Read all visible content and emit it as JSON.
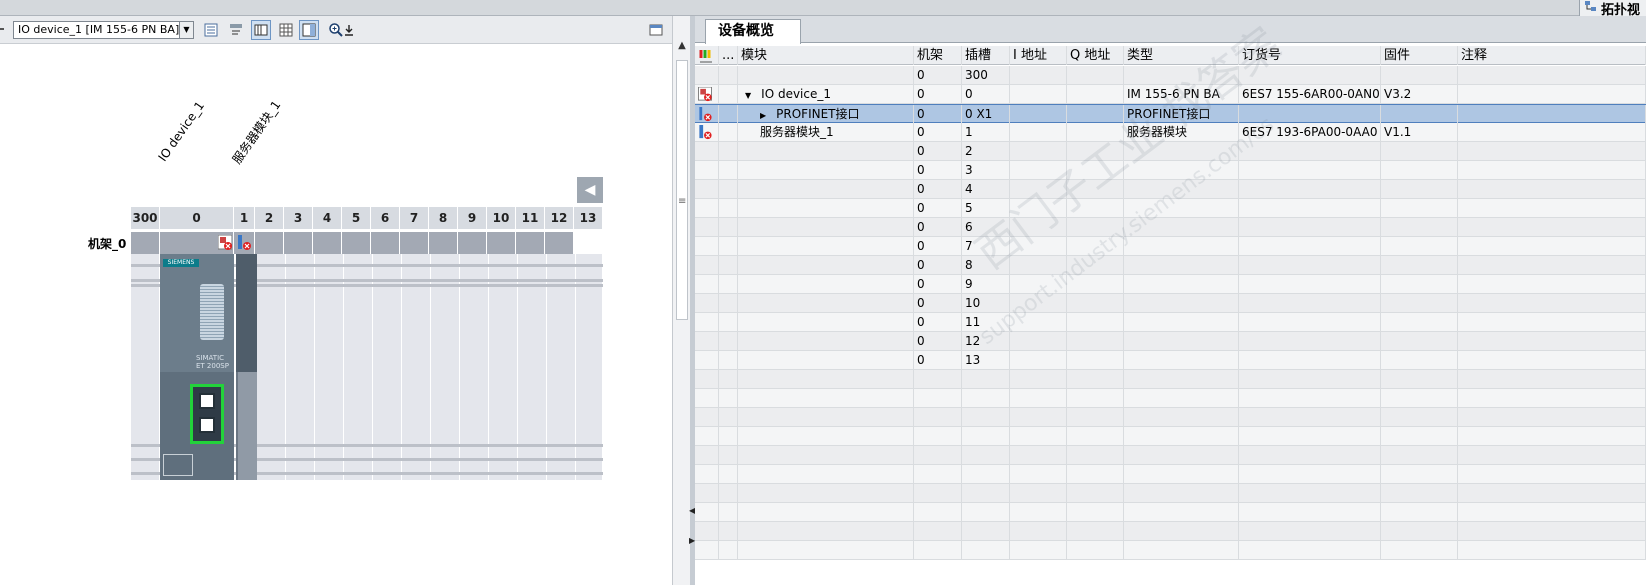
{
  "topbar": {
    "topology_tab_label": "拓扑视"
  },
  "left_toolbar": {
    "device_selector_value": "IO device_1 [IM 155-6 PN BA]"
  },
  "rack": {
    "column_labels": [
      "IO device_1",
      "服务器模块_1"
    ],
    "row_label": "机架_0",
    "slots": [
      "300",
      "0",
      "1",
      "2",
      "3",
      "4",
      "5",
      "6",
      "7",
      "8",
      "9",
      "10",
      "11",
      "12",
      "13"
    ],
    "module_text": {
      "brand": "SIEMENS",
      "product": "SIMATIC\nET 200SP"
    }
  },
  "overview": {
    "tab_label": "设备概览",
    "columns": [
      "...",
      "模块",
      "机架",
      "插槽",
      "I 地址",
      "Q 地址",
      "类型",
      "订货号",
      "固件",
      "注释"
    ],
    "rows": [
      {
        "expander": "",
        "module": "",
        "rack": "0",
        "slot": "300",
        "type": "",
        "order": "",
        "fw": "",
        "status": ""
      },
      {
        "expander": "▼",
        "module": "IO device_1",
        "rack": "0",
        "slot": "0",
        "type": "IM 155-6 PN BA",
        "order": "6ES7 155-6AR00-0AN0",
        "fw": "V3.2",
        "status": "device"
      },
      {
        "expander": "▶",
        "module": "PROFINET接口",
        "rack": "0",
        "slot": "0 X1",
        "type": "PROFINET接口",
        "order": "",
        "fw": "",
        "status": "error",
        "selected": true
      },
      {
        "expander": "",
        "module": "服务器模块_1",
        "rack": "0",
        "slot": "1",
        "type": "服务器模块",
        "order": "6ES7 193-6PA00-0AA0",
        "fw": "V1.1",
        "status": "server"
      },
      {
        "module": "",
        "rack": "0",
        "slot": "2"
      },
      {
        "module": "",
        "rack": "0",
        "slot": "3"
      },
      {
        "module": "",
        "rack": "0",
        "slot": "4"
      },
      {
        "module": "",
        "rack": "0",
        "slot": "5"
      },
      {
        "module": "",
        "rack": "0",
        "slot": "6"
      },
      {
        "module": "",
        "rack": "0",
        "slot": "7"
      },
      {
        "module": "",
        "rack": "0",
        "slot": "8"
      },
      {
        "module": "",
        "rack": "0",
        "slot": "9"
      },
      {
        "module": "",
        "rack": "0",
        "slot": "10"
      },
      {
        "module": "",
        "rack": "0",
        "slot": "11"
      },
      {
        "module": "",
        "rack": "0",
        "slot": "12"
      },
      {
        "module": "",
        "rack": "0",
        "slot": "13"
      }
    ]
  },
  "watermark": {
    "line1": "西门子工业 找答案",
    "line2": "support.industry.siemens.com/cs"
  }
}
